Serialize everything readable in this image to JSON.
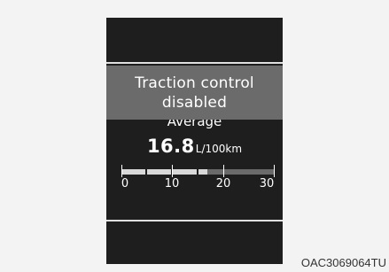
{
  "popup": {
    "line1": "Traction control",
    "line2": "disabled"
  },
  "fuel": {
    "label": "Average",
    "value": "16.8",
    "unit": "L/100km",
    "gauge_level": 0.56,
    "scale_labels": [
      "0",
      "10",
      "20",
      "30"
    ]
  },
  "caption": "OAC3069064TU",
  "colors": {
    "panel": "#1e1e1e",
    "popup": "#6b6b6b",
    "text": "#ffffff",
    "gauge_fill": "#d8d8d8",
    "gauge_track": "#6a6a6a"
  }
}
